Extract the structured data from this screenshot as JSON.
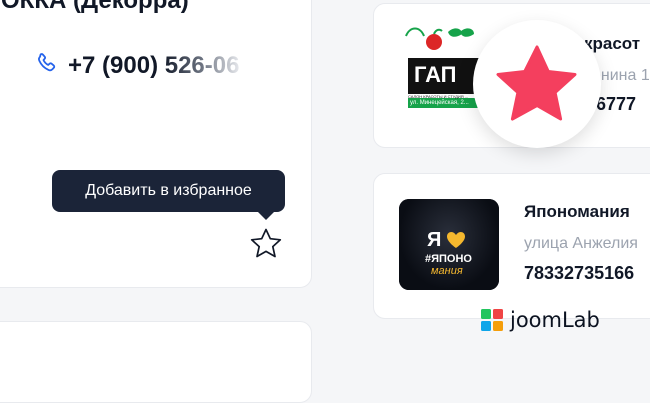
{
  "left_card": {
    "title": "ОККА (Декорра)",
    "phone": "+7 (900) 526-06"
  },
  "tooltip": {
    "text": "Добавить в избранное"
  },
  "listings": [
    {
      "name": "красот",
      "address": "енина 1",
      "phone": "6777",
      "logo": {
        "line1": "ГАП",
        "line2": "САЛОН КРАСОТЫ И СТУДИЯ ...",
        "line3": "ул. Минецейская, 2..."
      }
    },
    {
      "name": "Япономания",
      "address": "улица Анжелия",
      "phone": "78332735166",
      "logo": {
        "line1": "Я",
        "line2": "#ЯПОНО",
        "line3": "мания"
      }
    }
  ],
  "brand": {
    "name": "joomLab"
  },
  "colors": {
    "accent_star": "#f43f5e",
    "tooltip_bg": "#1b2438",
    "phone_icon": "#2563eb"
  }
}
